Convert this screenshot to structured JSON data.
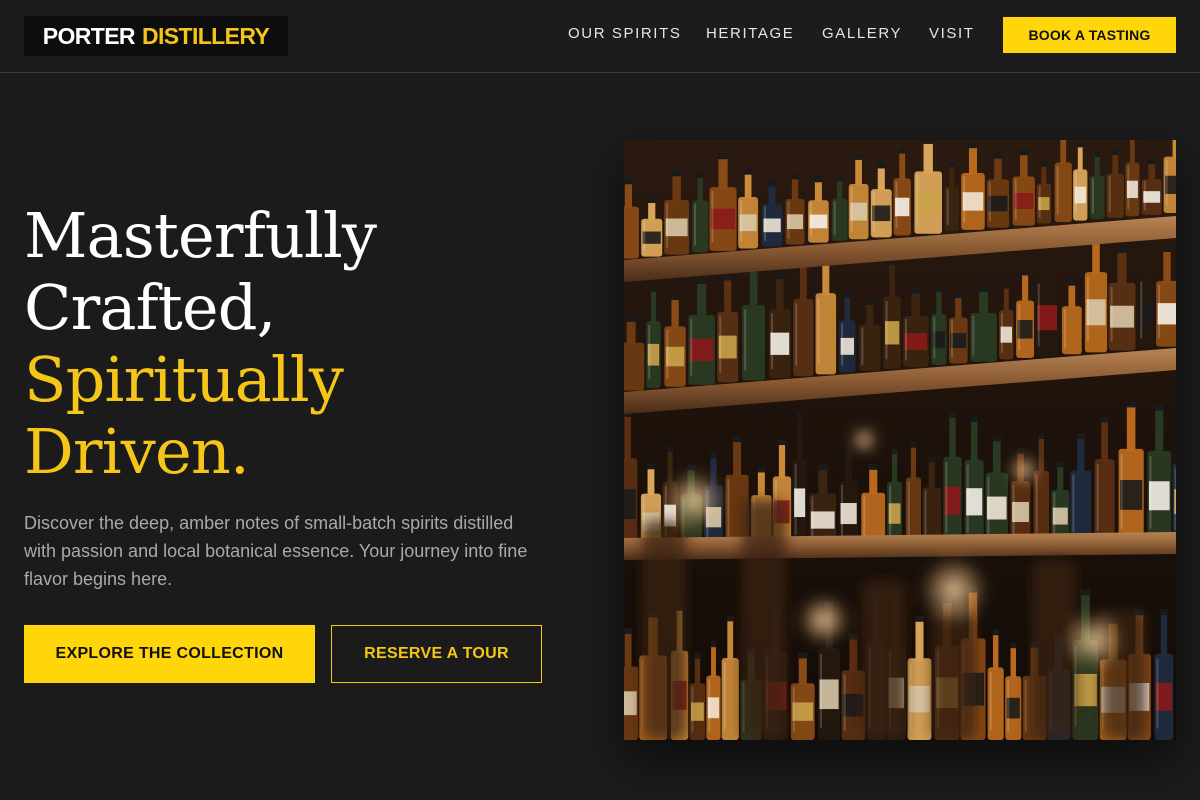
{
  "brand": {
    "name_first": "PORTER",
    "name_second": "DISTILLERY"
  },
  "nav": {
    "items": [
      "OUR SPIRITS",
      "HERITAGE",
      "GALLERY",
      "VISIT"
    ],
    "cta_label": "BOOK A TASTING"
  },
  "hero": {
    "title_lines_white": [
      "Masterfully",
      "Crafted,"
    ],
    "title_lines_gold": [
      "Spiritually",
      "Driven."
    ],
    "description": "Discover the deep, amber notes of small-batch spirits distilled with passion and local botanical essence. Your journey into fine flavor begins here.",
    "primary_button": "EXPLORE THE COLLECTION",
    "secondary_button": "RESERVE A TOUR"
  },
  "image": {
    "subject": "bar-shelves-with-liquor-bottles"
  },
  "colors": {
    "background": "#1b1b1b",
    "accent": "#ffd60a",
    "gold_text": "#f5c518",
    "muted_text": "#a9a9a9"
  }
}
